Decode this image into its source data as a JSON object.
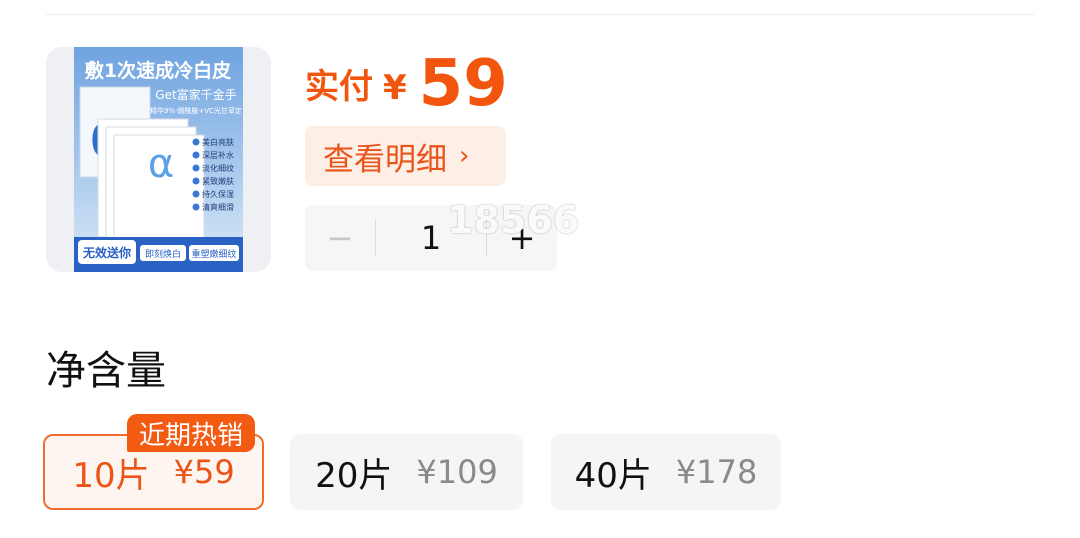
{
  "product": {
    "image": {
      "headline": "敷1次速成冷白皮",
      "sub": "Get富家千金手",
      "tagline": "精华9%·烟酰胺+VC光甘草定",
      "alpha": "α",
      "features": [
        "美白亮肤",
        "深层补水",
        "淡化细纹",
        "紧致嫩肤",
        "持久保湿",
        "清爽细滑"
      ],
      "badge": "无效送你",
      "chip1": "即刻焕白",
      "chip2": "重塑嫩细纹",
      "brand_color": "#1f5fb8"
    },
    "price_label": "实付",
    "currency": "¥",
    "price": "59",
    "detail_label": "查看明细",
    "detail_chevron": "›",
    "quantity": "1",
    "minus": "−",
    "plus": "+",
    "watermark": "18566"
  },
  "spec": {
    "title": "净含量",
    "hot_badge": "近期热销",
    "options": [
      {
        "name": "10片",
        "price": "¥59",
        "selected": true
      },
      {
        "name": "20片",
        "price": "¥109",
        "selected": false
      },
      {
        "name": "40片",
        "price": "¥178",
        "selected": false
      }
    ]
  },
  "colors": {
    "accent": "#f2550d",
    "accent_bg": "#fdeee6",
    "selected_border": "#f26b2f"
  }
}
